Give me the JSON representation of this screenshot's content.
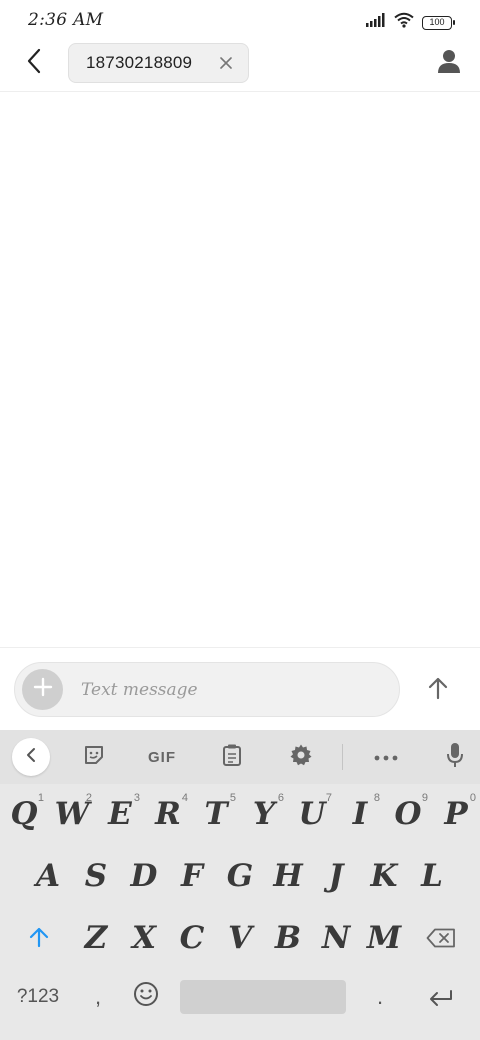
{
  "status_bar": {
    "time": "2:36 AM",
    "battery": "100",
    "icons": [
      "signal-icon",
      "wifi-icon",
      "battery-icon"
    ]
  },
  "header": {
    "recipient": "18730218809",
    "icons": [
      "back-arrow-icon",
      "chip-close-icon",
      "contact-icon"
    ]
  },
  "compose": {
    "placeholder": "Text message",
    "icons": [
      "plus-icon",
      "send-arrow-icon"
    ]
  },
  "keyboard": {
    "toolbar": {
      "gif_label": "GIF",
      "icons": [
        "chevron-left-icon",
        "sticker-icon",
        "clipboard-icon",
        "gear-icon",
        "more-dots-icon",
        "microphone-icon"
      ]
    },
    "row1": [
      {
        "key": "Q",
        "hint": "1"
      },
      {
        "key": "W",
        "hint": "2"
      },
      {
        "key": "E",
        "hint": "3"
      },
      {
        "key": "R",
        "hint": "4"
      },
      {
        "key": "T",
        "hint": "5"
      },
      {
        "key": "Y",
        "hint": "6"
      },
      {
        "key": "U",
        "hint": "7"
      },
      {
        "key": "I",
        "hint": "8"
      },
      {
        "key": "O",
        "hint": "9"
      },
      {
        "key": "P",
        "hint": "0"
      }
    ],
    "row2": [
      "A",
      "S",
      "D",
      "F",
      "G",
      "H",
      "J",
      "K",
      "L"
    ],
    "row3": [
      "Z",
      "X",
      "C",
      "V",
      "B",
      "N",
      "M"
    ],
    "row4": {
      "symbols": "?123",
      "comma": ",",
      "period": "."
    },
    "accent_color": "#2196F3"
  }
}
